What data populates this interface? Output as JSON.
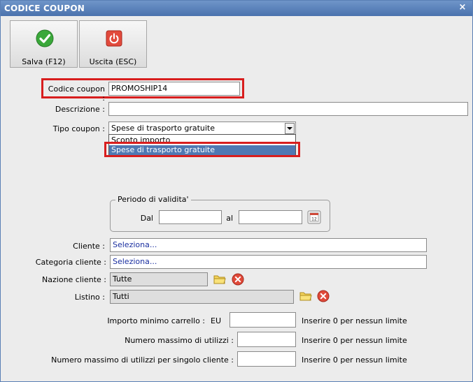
{
  "window": {
    "title": "CODICE COUPON",
    "close_glyph": "×"
  },
  "toolbar": {
    "save_label": "Salva (F12)",
    "exit_label": "Uscita (ESC)"
  },
  "form": {
    "codice_label": "Codice coupon :",
    "codice_value": "PROMOSHIP14",
    "descrizione_label": "Descrizione :",
    "descrizione_value": "",
    "tipo_label": "Tipo coupon :",
    "tipo_value": "Spese di trasporto gratuite",
    "tipo_options": [
      "Sconto importo",
      "Spese di trasporto gratuite"
    ],
    "periodo_label": "Periodo di validita'",
    "dal_label": "Dal",
    "al_label": "al",
    "dal_value": "",
    "al_value": "",
    "cliente_label": "Cliente :",
    "cliente_value": "Seleziona...",
    "categoria_label": "Categoria cliente :",
    "categoria_value": "Seleziona...",
    "nazione_label": "Nazione cliente :",
    "nazione_value": "Tutte",
    "listino_label": "Listino :",
    "listino_value": "Tutti",
    "importo_label": "Importo minimo carrello :",
    "importo_unit": "EU",
    "importo_value": "",
    "max_utilizzi_label": "Numero massimo di utilizzi :",
    "max_utilizzi_value": "",
    "max_cliente_label": "Numero massimo di utilizzi per singolo cliente :",
    "max_cliente_value": "",
    "hint": "Inserire 0 per nessun limite"
  },
  "colors": {
    "highlight": "#d81e1e",
    "selection": "#4f79b3",
    "title_bar": "#4a72ad"
  }
}
